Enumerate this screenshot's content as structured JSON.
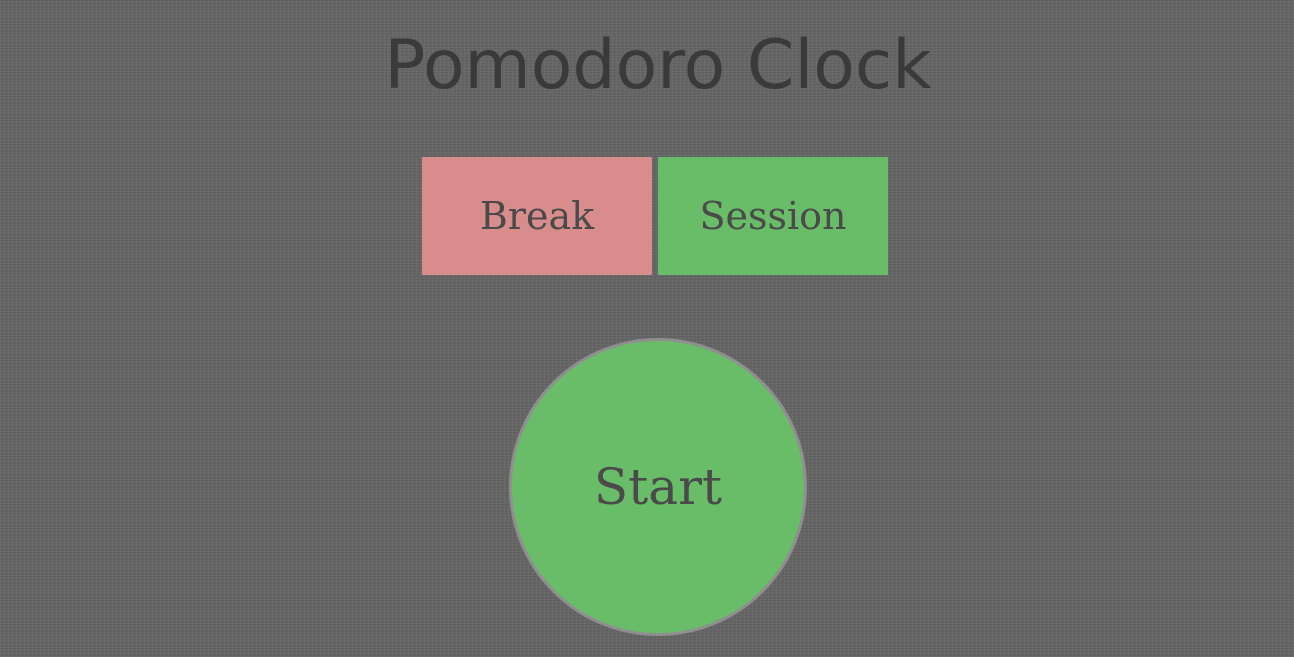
{
  "app": {
    "title": "Pomodoro Clock"
  },
  "modes": {
    "break_label": "Break",
    "session_label": "Session",
    "break_color": "#d88c8c",
    "session_color": "#69bd69"
  },
  "timer": {
    "start_label": "Start",
    "active_color": "#69bd69"
  },
  "theme": {
    "background": "#636363",
    "text_color": "#3a3a3a"
  }
}
